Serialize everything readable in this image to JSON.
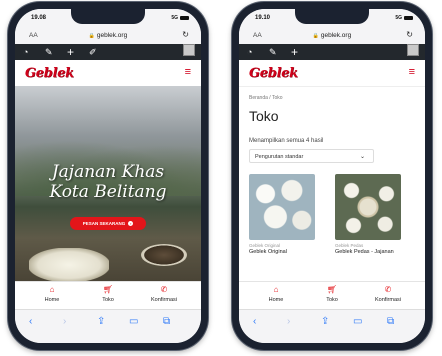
{
  "left": {
    "status": {
      "time": "19.08",
      "signal": "5G"
    },
    "browser": {
      "aa": "AA",
      "url": "geblek.org"
    },
    "site": {
      "logo": "Geblek"
    },
    "hero": {
      "line1": "Jajanan Khas",
      "line2": "Kota Belitang",
      "cta": "PESAN SEKARANG"
    },
    "tabs": [
      {
        "label": "Home",
        "icon": "home-icon"
      },
      {
        "label": "Toko",
        "icon": "cart-icon"
      },
      {
        "label": "Konfirmasi",
        "icon": "whatsapp-icon"
      }
    ]
  },
  "right": {
    "status": {
      "time": "19.10",
      "signal": "5G"
    },
    "browser": {
      "aa": "AA",
      "url": "geblek.org"
    },
    "site": {
      "logo": "Geblek"
    },
    "breadcrumb": "Beranda / Toko",
    "title": "Toko",
    "result_count": "Menampilkan semua 4 hasil",
    "sort": {
      "selected": "Pengurutan standar"
    },
    "products": [
      {
        "category": "Geblek Original",
        "name": "Geblek Original"
      },
      {
        "category": "Geblek Pedas",
        "name": "Geblek Pedas - Jajanan"
      }
    ],
    "tabs": [
      {
        "label": "Home",
        "icon": "home-icon"
      },
      {
        "label": "Toko",
        "icon": "cart-icon"
      },
      {
        "label": "Konfirmasi",
        "icon": "whatsapp-icon"
      }
    ]
  },
  "colors": {
    "brand_red": "#e3151a",
    "logo_red": "#d0021b",
    "wp_bar": "#23282d",
    "link_blue": "#2f7af8"
  }
}
